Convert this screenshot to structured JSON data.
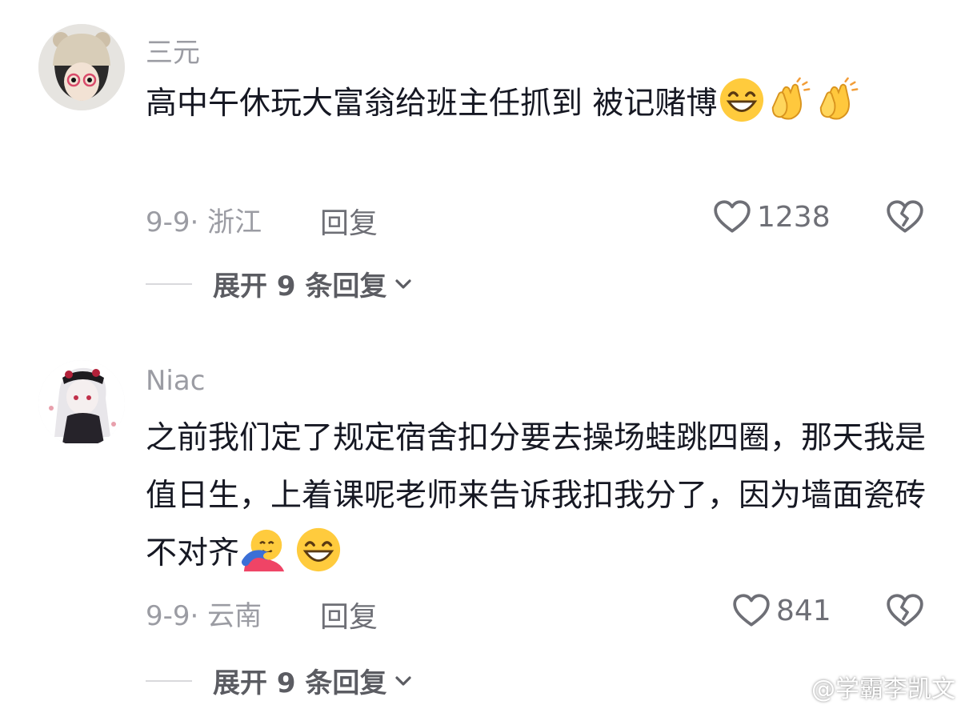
{
  "comments": [
    {
      "username": "三元",
      "text": "高中午休玩大富翁给班主任抓到 被记赌博",
      "emojis": [
        "grin-emoji",
        "clap-emoji",
        "clap-emoji"
      ],
      "date": "9-9",
      "location": "浙江",
      "reply_label": "回复",
      "likes": "1238",
      "expand_label": "展开 9 条回复"
    },
    {
      "username": "Niac",
      "text": "之前我们定了规定宿舍扣分要去操场蛙跳四圈，那天我是值日生，上着课呢老师来告诉我扣我分了，因为墙面瓷砖不对齐",
      "emojis": [
        "hug-emoji",
        "grin-emoji"
      ],
      "date": "9-9",
      "location": "云南",
      "reply_label": "回复",
      "likes": "841",
      "expand_label": "展开 9 条回复"
    }
  ],
  "watermark": "@学霸李凯文",
  "colors": {
    "text": "#161823",
    "secondary": "#9b9ca3",
    "action": "#6e6f76"
  }
}
